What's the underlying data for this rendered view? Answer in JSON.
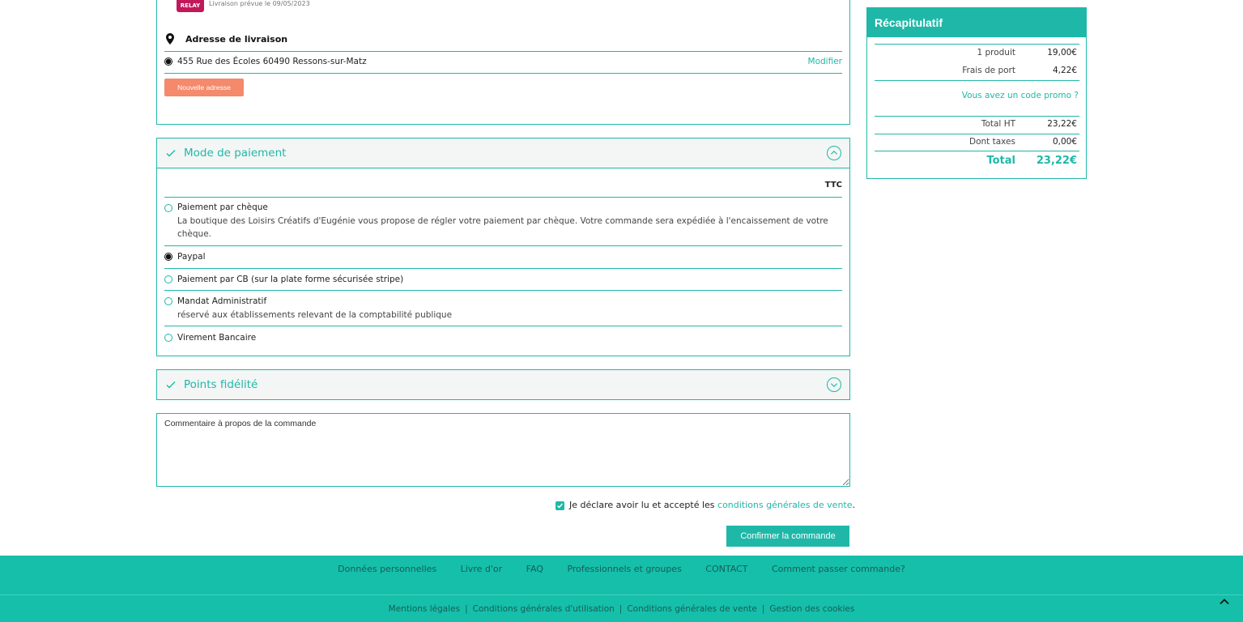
{
  "relay": {
    "logo_text": "RELAY",
    "delivery_date": "Livraison prévue le 09/05/2023"
  },
  "address": {
    "title": "Adresse de livraison",
    "selected_address": "455 Rue des Écoles 60490 Ressons-sur-Matz",
    "modify_label": "Modifier",
    "new_address_label": "Nouvelle adresse"
  },
  "payment": {
    "title": "Mode de paiement",
    "ttc_label": "TTC",
    "options": [
      {
        "label": "Paiement par chèque",
        "desc": "La boutique des Loisirs Créatifs d'Eugénie vous propose de régler votre paiement par chèque. Votre commande sera expédiée à l'encaissement de votre chèque."
      },
      {
        "label": "Paypal",
        "desc": ""
      },
      {
        "label": "Paiement par CB (sur la plate forme sécurisée stripe)",
        "desc": ""
      },
      {
        "label": "Mandat Administratif",
        "desc": "réservé aux établissements relevant de la comptabilité publique"
      },
      {
        "label": "Virement Bancaire",
        "desc": ""
      }
    ]
  },
  "loyalty": {
    "title": "Points fidélité"
  },
  "comment": {
    "placeholder": "Commentaire à propos de la commande"
  },
  "terms": {
    "prefix": "Je déclare avoir lu et accepté les",
    "link": "conditions générales de vente",
    "suffix": "."
  },
  "confirm_label": "Confirmer la commande",
  "summary": {
    "title": "Récapitulatif",
    "products_label": "1 produit",
    "products_value": "19,00€",
    "shipping_label": "Frais de port",
    "shipping_value": "4,22€",
    "promo_label": "Vous avez un code promo ?",
    "total_ht_label": "Total HT",
    "total_ht_value": "23,22€",
    "taxes_label": "Dont taxes",
    "taxes_value": "0,00€",
    "total_label": "Total",
    "total_value": "23,22€"
  },
  "footer": {
    "nav": [
      "Données personnelles",
      "Livre d'or",
      "FAQ",
      "Professionnels et groupes",
      "CONTACT",
      "Comment passer commande?"
    ],
    "legal": [
      "Mentions légales",
      "Conditions générales d'utilisation",
      "Conditions générales de vente",
      "Gestion des cookies"
    ]
  },
  "colors": {
    "accent": "#1fb8a8",
    "footer_bg": "#16bfaa",
    "new_address_button": "#f4896b",
    "relay_logo": "#c1185b"
  }
}
